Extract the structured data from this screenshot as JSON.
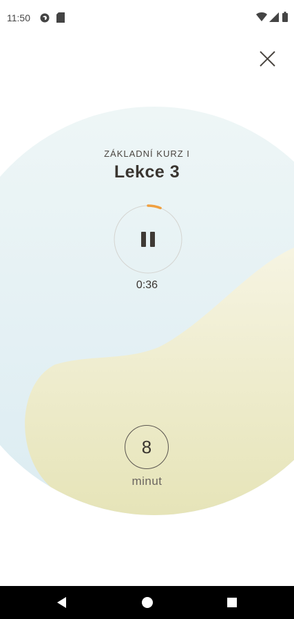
{
  "status_bar": {
    "time": "11:50",
    "icons": [
      "pocket-casts-icon",
      "sim-card-icon",
      "wifi-icon",
      "cell-signal-icon",
      "battery-icon"
    ]
  },
  "lesson": {
    "course": "ZÁKLADNÍ KURZ I",
    "title": "Lekce 3"
  },
  "player": {
    "state": "playing",
    "control_icon": "pause-icon",
    "elapsed": "0:36",
    "progress": 0.06,
    "progress_color": "#f0a040"
  },
  "duration": {
    "value": "8",
    "unit": "minut"
  },
  "nav": {
    "buttons": [
      "back-icon",
      "home-icon",
      "recents-icon"
    ]
  },
  "colors": {
    "blue_blob": "#e6f3f6",
    "yellow_blob": "#eeebc6"
  }
}
